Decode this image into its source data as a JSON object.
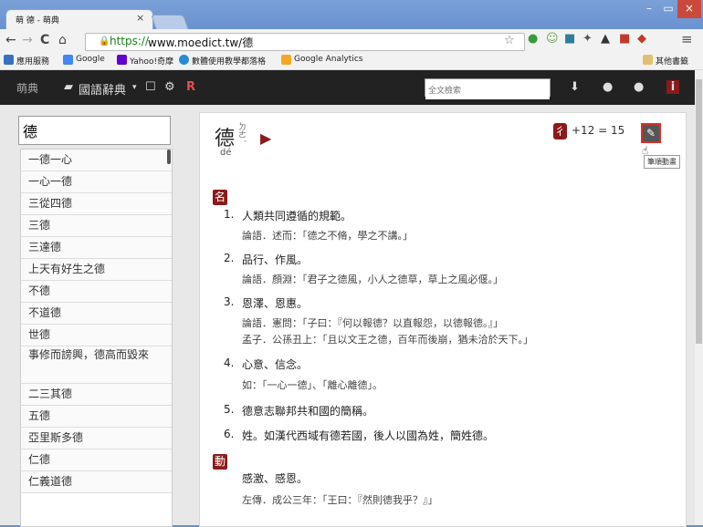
{
  "browser": {
    "tab_title": "萌 德 - 萌典",
    "tab_close": "×",
    "window_buttons": {
      "min": "–",
      "max": "▭",
      "close": "×"
    },
    "nav": {
      "back": "←",
      "forward": "→",
      "reload": "C",
      "home": "⌂"
    },
    "url_scheme": "https://",
    "url_host": "www.moedict.tw/德",
    "bookmarks": [
      {
        "label": "應用服務",
        "color": "#3a6fc4"
      },
      {
        "label": "Google",
        "color": "#4285f4"
      },
      {
        "label": "Yahoo!奇摩",
        "color": "#6001d2"
      },
      {
        "label": "數體使用教學都落格",
        "color": "#2a8ad4"
      },
      {
        "label": "Google Analytics",
        "color": "#f5a623"
      },
      {
        "label": "其他書籤",
        "color": "#e0c070"
      }
    ]
  },
  "toolbar": {
    "logo": "萌典",
    "dict_menu": "國語辭典",
    "search_placeholder": "全文檢索"
  },
  "sidebar": {
    "query": "德",
    "items": [
      "一德一心",
      "一心一德",
      "三從四德",
      "三德",
      "三達德",
      "上天有好生之德",
      "不德",
      "不道德",
      "世德",
      "事修而謗興，德高而毀來",
      "二三其德",
      "五德",
      "亞里斯多德",
      "仁德",
      "仁義道德"
    ]
  },
  "entry": {
    "char": "德",
    "zhuyin": "ㄉㄜˊ",
    "pinyin": "dé",
    "radical": "彳",
    "strokes": "+12 = 15",
    "edit_tooltip": "筆順動畫",
    "pos_noun": "名",
    "pos_verb": "動",
    "definitions": [
      {
        "num": "1.",
        "text": "人類共同遵循的規範。",
        "examples": [
          "論語．述而：「德之不脩，學之不講。」"
        ]
      },
      {
        "num": "2.",
        "text": "品行、作風。",
        "examples": [
          "論語．顏淵：「君子之德風，小人之德草，草上之風必偃。」"
        ]
      },
      {
        "num": "3.",
        "text": "恩澤、恩惠。",
        "examples": [
          "論語．憲問：「子曰：『何以報德？以直報怨，以德報德。』」",
          "孟子．公孫丑上：「且以文王之德，百年而後崩，猶未洽於天下。」"
        ]
      },
      {
        "num": "4.",
        "text": "心意、信念。",
        "examples": [
          "如：「一心一德」、「離心離德」。"
        ]
      },
      {
        "num": "5.",
        "text": "德意志聯邦共和國的簡稱。",
        "examples": []
      },
      {
        "num": "6.",
        "text": "姓。如漢代西域有德若國，後人以國為姓，簡姓德。",
        "examples": []
      }
    ],
    "verb_def": "感激、感恩。",
    "verb_example": "左傳．成公三年：「王曰：『然則德我乎？』」"
  }
}
